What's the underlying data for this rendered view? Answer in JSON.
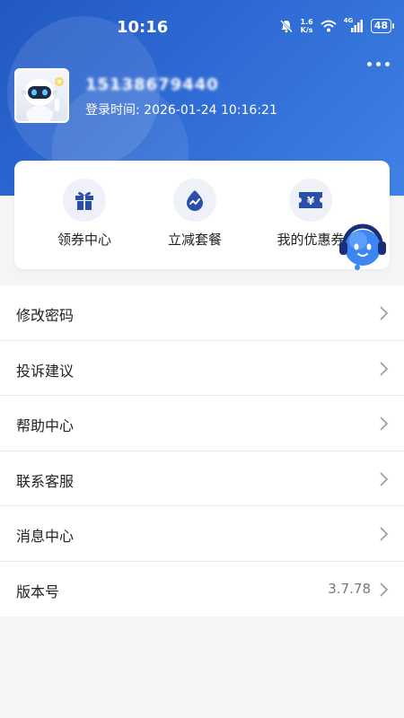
{
  "statusbar": {
    "time": "10:16",
    "net_speed_value": "1.6",
    "net_speed_unit": "K/s",
    "network": "4G",
    "battery": "48"
  },
  "user": {
    "phone": "15138679440",
    "login_label": "登录时间:",
    "login_time": "2026-01-24 10:16:21"
  },
  "quick_actions": [
    {
      "label": "领券中心",
      "icon": "gift-icon"
    },
    {
      "label": "立减套餐",
      "icon": "trend-icon"
    },
    {
      "label": "我的优惠券",
      "icon": "coupon-icon"
    }
  ],
  "menu": [
    {
      "label": "修改密码"
    },
    {
      "label": "投诉建议"
    },
    {
      "label": "帮助中心"
    },
    {
      "label": "联系客服"
    },
    {
      "label": "消息中心"
    },
    {
      "label": "版本号",
      "value": "3.7.78"
    }
  ],
  "colors": {
    "header_start": "#2258c2",
    "header_end": "#3f82e4",
    "icon_blue": "#2b4ea8",
    "icon_bg": "#eef1f7"
  }
}
